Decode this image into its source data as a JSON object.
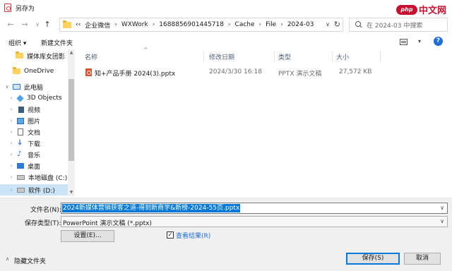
{
  "window": {
    "title": "另存为"
  },
  "watermark": {
    "logo": "php",
    "text": "中文网"
  },
  "nav_buttons": {
    "back": "←",
    "forward": "→",
    "dropdown": "∨",
    "up": "↑"
  },
  "address": {
    "overflow": "‹‹",
    "crumbs": [
      "企业微信",
      "WXWork",
      "1688856901445718",
      "Cache",
      "File",
      "2024-03"
    ],
    "separator": "›",
    "dropdown": "∨",
    "refresh": "↻"
  },
  "search": {
    "placeholder": "在 2024-03 中搜索"
  },
  "toolbar": {
    "organize": "组织 ▾",
    "new_folder": "新建文件夹",
    "view_dropdown": "▾",
    "help": "?"
  },
  "nav_pane": {
    "items": [
      {
        "label": "媒体库女团影",
        "icon": "folder-icon",
        "pinned": true
      },
      {
        "label": "OneDrive",
        "icon": "folder-icon"
      },
      {
        "label": "此电脑",
        "icon": "pc-icon",
        "chevron": "∨"
      },
      {
        "label": "3D Objects",
        "icon": "3d-objects-icon",
        "chevron": "›"
      },
      {
        "label": "视频",
        "icon": "video-icon",
        "chevron": "›"
      },
      {
        "label": "图片",
        "icon": "pictures-icon",
        "chevron": "›"
      },
      {
        "label": "文档",
        "icon": "documents-icon",
        "chevron": "›"
      },
      {
        "label": "下载",
        "icon": "download-icon",
        "chevron": "›"
      },
      {
        "label": "音乐",
        "icon": "music-icon",
        "chevron": "›"
      },
      {
        "label": "桌面",
        "icon": "desktop-icon",
        "chevron": "›"
      },
      {
        "label": "本地磁盘 (C:)",
        "icon": "drive-icon",
        "chevron": "›"
      },
      {
        "label": "软件 (D:)",
        "icon": "drive-icon",
        "chevron": "›",
        "selected": true
      }
    ],
    "pin_glyph": "📌"
  },
  "file_list": {
    "columns": [
      "名称",
      "修改日期",
      "类型",
      "大小"
    ],
    "sort_arrow": "^",
    "rows": [
      {
        "name": "知+产品手册 2024(3).pptx",
        "modified": "2024/3/30 16:18",
        "type": "PPTX 演示文稿",
        "size": "27,572 KB"
      }
    ]
  },
  "save_panel": {
    "filename_label": "文件名(N):",
    "filename_value": "2024新媒体营销获客之道-得到新商学&新榜-2024-55页.pptx",
    "filetype_label": "保存类型(T):",
    "filetype_value": "PowerPoint 演示文稿 (*.pptx)",
    "settings_button": "设置(E)...",
    "view_results_label": "查看结果(R)",
    "view_results_checked": true,
    "check_glyph": "✓",
    "hide_folders_label": "隐藏文件夹",
    "hide_chevron": "∧",
    "save_button": "保存(S)",
    "cancel_button": "取消"
  }
}
